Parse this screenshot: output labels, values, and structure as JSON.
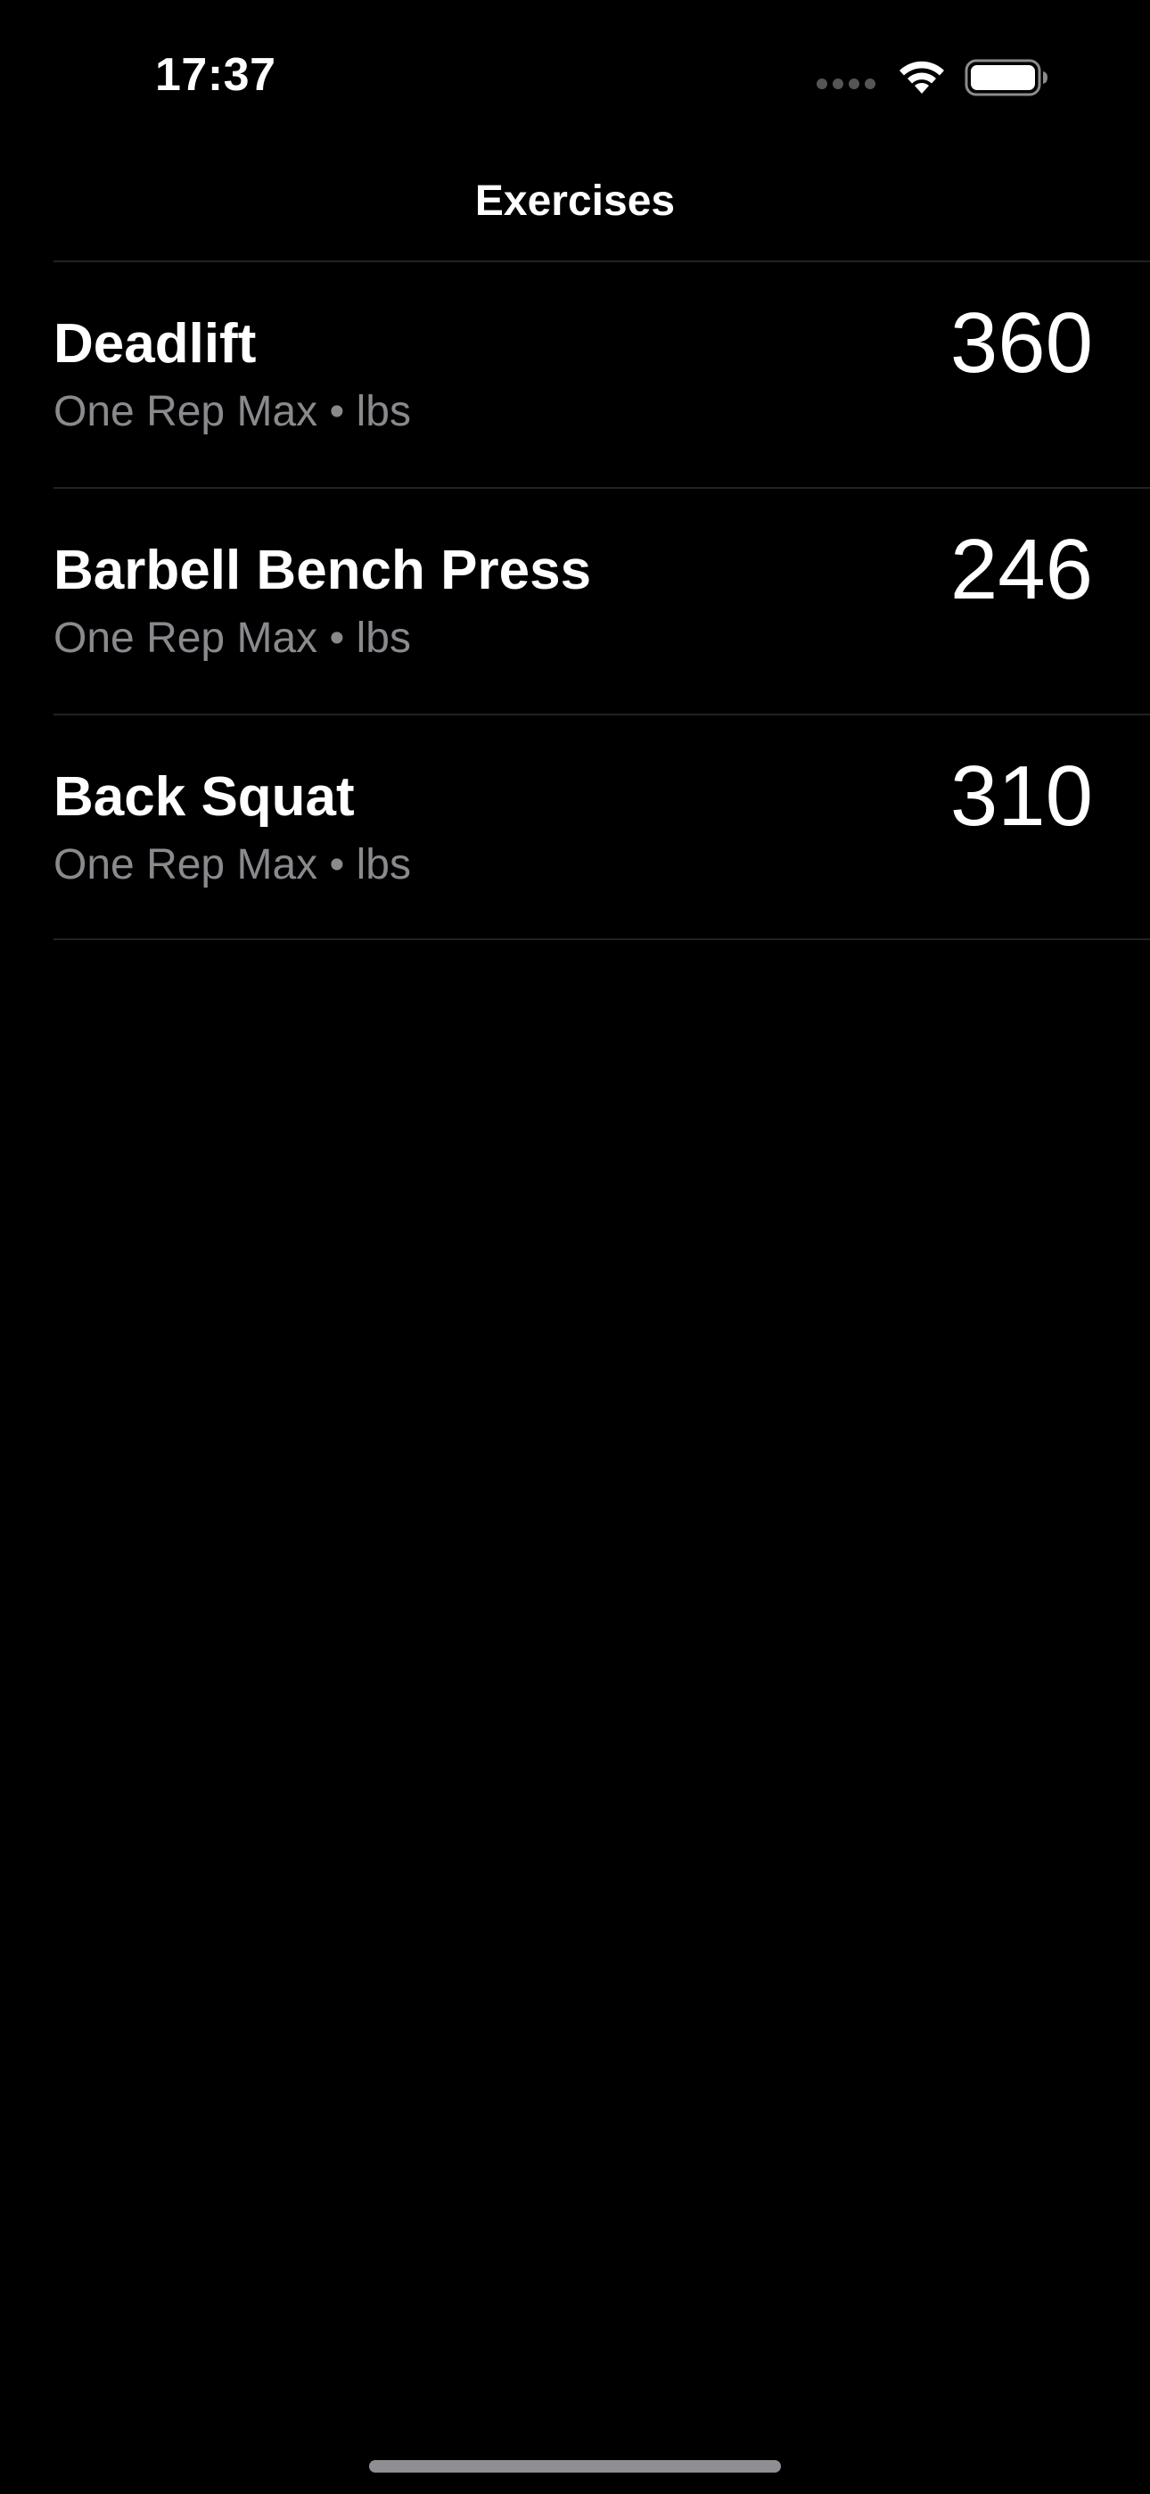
{
  "status_bar": {
    "time": "17:37",
    "signal_icon": "cellular-signal-icon",
    "wifi_icon": "wifi-icon",
    "battery_icon": "battery-icon"
  },
  "nav": {
    "title": "Exercises"
  },
  "exercises": [
    {
      "name": "Deadlift",
      "subtitle": "One Rep Max • lbs",
      "value": "360"
    },
    {
      "name": "Barbell Bench Press",
      "subtitle": "One Rep Max • lbs",
      "value": "246"
    },
    {
      "name": "Back Squat",
      "subtitle": "One Rep Max • lbs",
      "value": "310"
    }
  ],
  "colors": {
    "background": "#000000",
    "text_primary": "#ffffff",
    "text_secondary": "#8a8a8e",
    "separator": "#222222"
  }
}
